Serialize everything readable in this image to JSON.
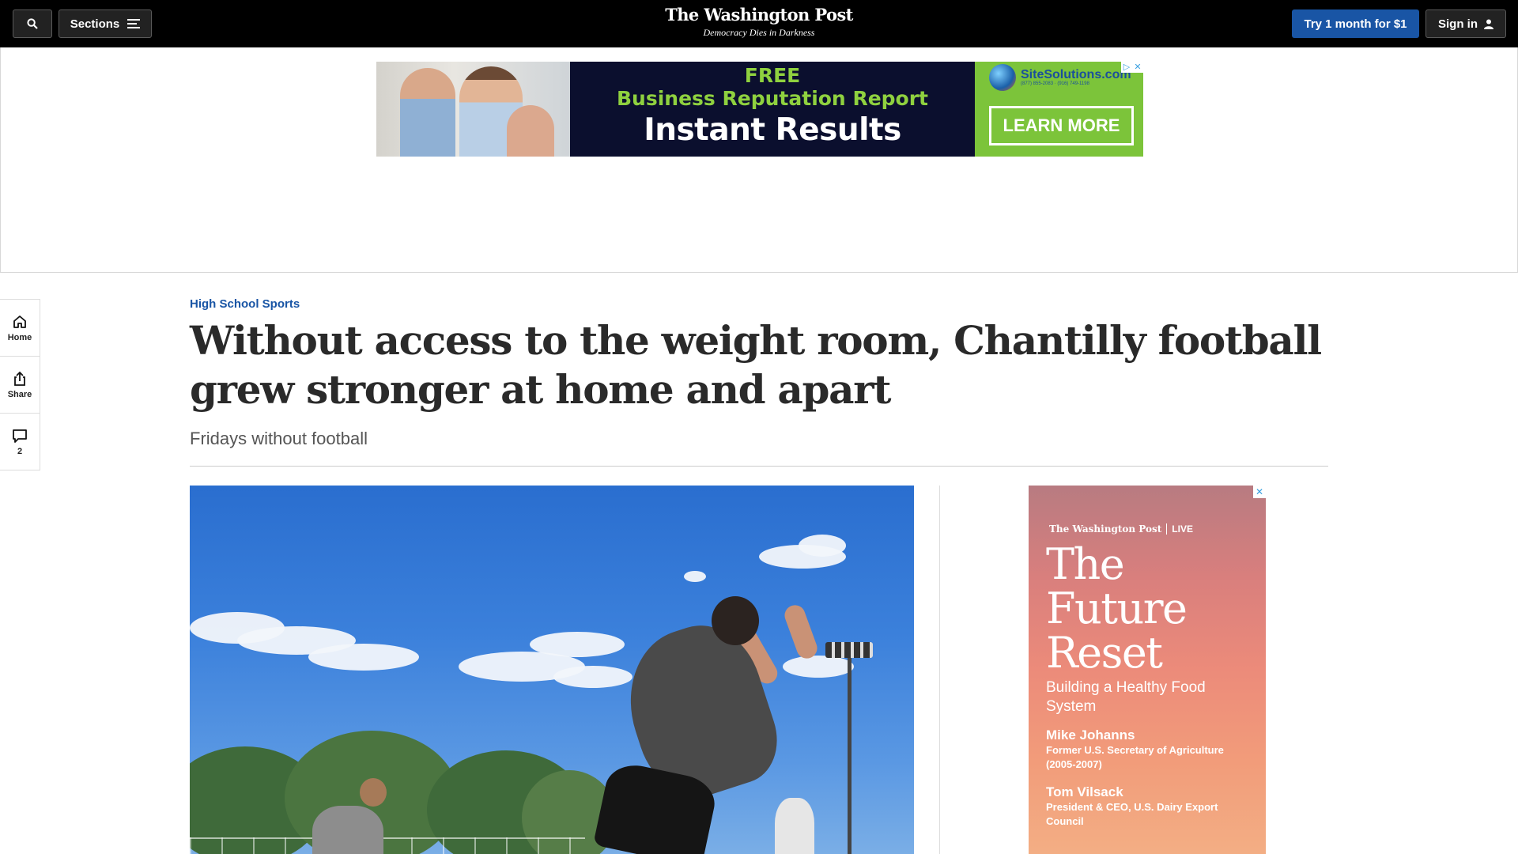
{
  "header": {
    "sections_label": "Sections",
    "logo": "The Washington Post",
    "tagline": "Democracy Dies in Darkness",
    "subscribe_label": "Try 1 month for $1",
    "signin_label": "Sign in",
    "colors": {
      "bar": "#000000",
      "subscribe": "#1955a5"
    }
  },
  "top_ad": {
    "line1": "FREE",
    "line2": "Business Reputation Report",
    "line3": "Instant Results",
    "brand": "SiteSolutions.com",
    "brand_phone": "(877) 855-2083 · (916) 749-1198",
    "cta": "LEARN MORE"
  },
  "rail": {
    "items": [
      {
        "icon": "home-icon",
        "label": "Home"
      },
      {
        "icon": "share-icon",
        "label": "Share"
      },
      {
        "icon": "comment-icon",
        "label": "2"
      }
    ]
  },
  "article": {
    "kicker": "High School Sports",
    "headline": "Without access to the weight room, Chantilly football grew stronger at home and apart",
    "dek": "Fridays without football"
  },
  "side_ad": {
    "brand": "The Washington Post",
    "brand_live": "LIVE",
    "title": "The Future Reset",
    "subtitle": "Building a Healthy Food System",
    "speakers": [
      {
        "name": "Mike Johanns",
        "role": "Former U.S. Secretary of Agriculture (2005-2007)"
      },
      {
        "name": "Tom Vilsack",
        "role": "President & CEO, U.S. Dairy Export Council"
      }
    ]
  }
}
